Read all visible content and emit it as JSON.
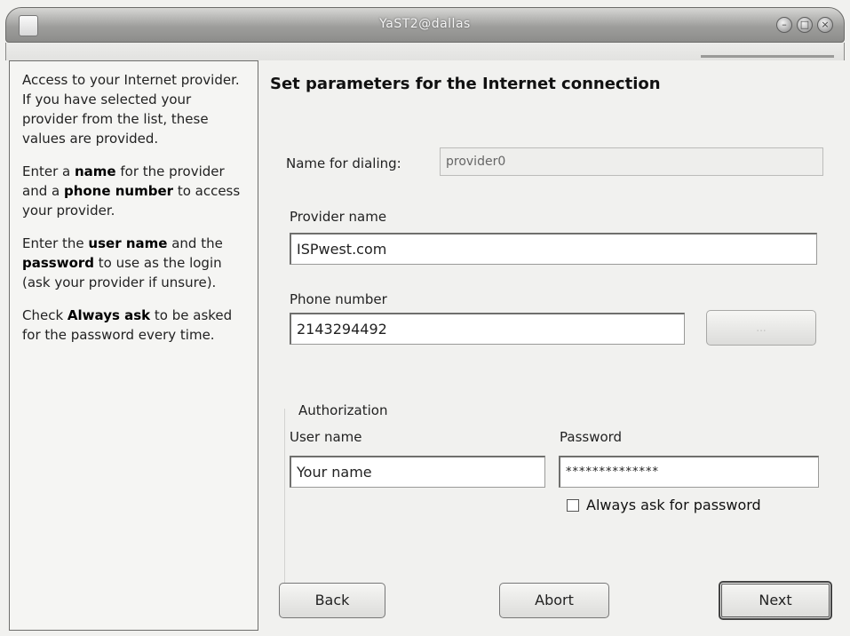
{
  "window": {
    "title": "YaST2@dallas",
    "controls": [
      "minimize-icon",
      "maximize-icon",
      "close-icon"
    ]
  },
  "help": {
    "paragraphs": [
      [
        {
          "t": "Access to your Internet provider. If you have selected your provider from the list, these values are provided."
        }
      ],
      [
        {
          "t": "Enter a "
        },
        {
          "t": "name",
          "b": true
        },
        {
          "t": " for the provider and a "
        },
        {
          "t": "phone number",
          "b": true
        },
        {
          "t": " to access your provider."
        }
      ],
      [
        {
          "t": "Enter the "
        },
        {
          "t": "user name",
          "b": true
        },
        {
          "t": " and the "
        },
        {
          "t": "password",
          "b": true
        },
        {
          "t": " to use as the login (ask your provider if unsure)."
        }
      ],
      [
        {
          "t": "Check "
        },
        {
          "t": "Always ask",
          "b": true
        },
        {
          "t": " to be asked for the password every time."
        }
      ]
    ]
  },
  "form": {
    "heading": "Set parameters for the Internet connection",
    "dial_name": {
      "label": "Name for dialing:",
      "value": "provider0"
    },
    "provider_name": {
      "label": "Provider name",
      "value": "ISPwest.com"
    },
    "phone_number": {
      "label": "Phone number",
      "value": "2143294492"
    },
    "phone_button_label": "...",
    "authorization": {
      "title": "Authorization",
      "user_label": "User name",
      "user_value": "Your name",
      "password_label": "Password",
      "password_value": "**************",
      "always_ask_label": "Always ask for password",
      "always_ask_checked": false
    }
  },
  "buttons": {
    "back": "Back",
    "abort": "Abort",
    "next": "Next"
  }
}
